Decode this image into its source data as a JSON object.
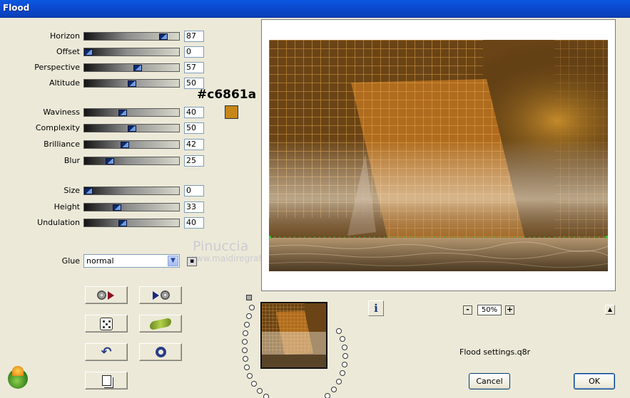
{
  "window": {
    "title": "Flood"
  },
  "sliders": [
    {
      "label": "Horizon",
      "value": 87,
      "level": 0.87
    },
    {
      "label": "Offset",
      "value": 0,
      "level": 0.0
    },
    {
      "label": "Perspective",
      "value": 57,
      "level": 0.57
    },
    {
      "label": "Altitude",
      "value": 50,
      "level": 0.5
    },
    {
      "label": "Waviness",
      "value": 40,
      "level": 0.4
    },
    {
      "label": "Complexity",
      "value": 50,
      "level": 0.5
    },
    {
      "label": "Brilliance",
      "value": 42,
      "level": 0.42
    },
    {
      "label": "Blur",
      "value": 25,
      "level": 0.25
    },
    {
      "label": "Size",
      "value": 0,
      "level": 0.0
    },
    {
      "label": "Height",
      "value": 33,
      "level": 0.33
    },
    {
      "label": "Undulation",
      "value": 40,
      "level": 0.4
    }
  ],
  "color": {
    "hex_label": "#c6861a",
    "swatch": "#c6861a"
  },
  "glue": {
    "label": "Glue",
    "value": "normal"
  },
  "watermark": {
    "line1": "Pinuccia",
    "line2": "www.maidiregrafica.eu"
  },
  "toolbar_icons": [
    "previous-preset-icon",
    "next-preset-icon",
    "randomize-dice-icon",
    "wave-icon",
    "reset-icon",
    "ring-icon",
    "new-preset-icon"
  ],
  "zoom": {
    "value": "50%",
    "minus": "-",
    "plus": "+"
  },
  "info": {
    "label": "i"
  },
  "status": {
    "file": "Flood settings.q8r"
  },
  "buttons": {
    "cancel": "Cancel",
    "ok": "OK"
  }
}
